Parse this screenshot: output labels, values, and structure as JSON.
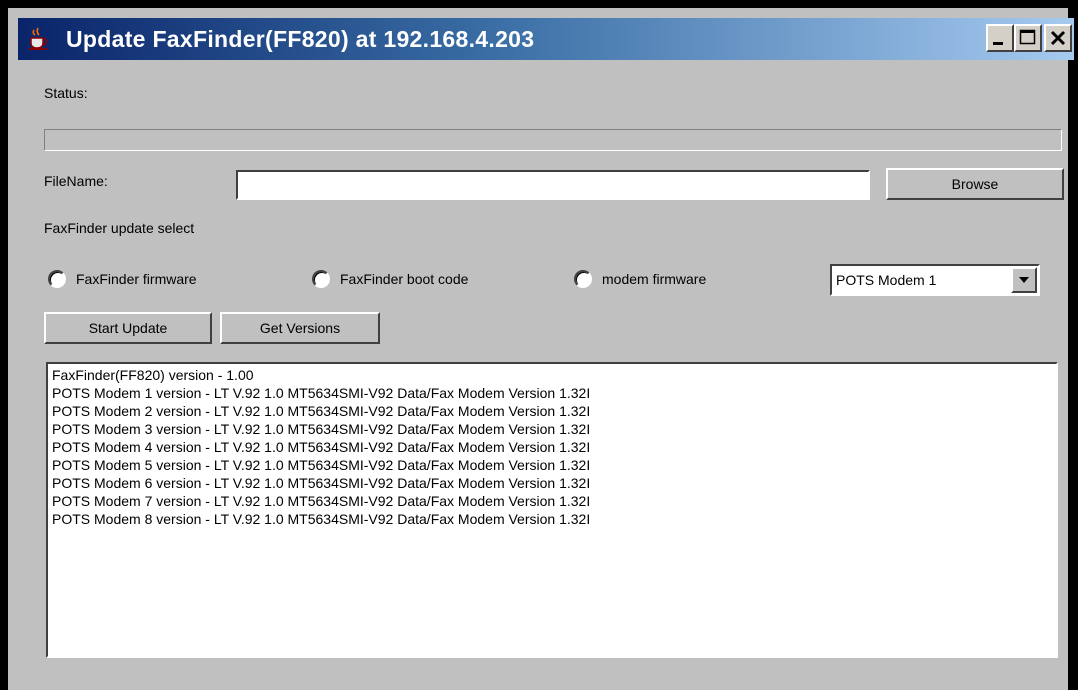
{
  "window": {
    "title": "Update FaxFinder(FF820) at 192.168.4.203",
    "controls": [
      "minimize-icon",
      "maximize-icon",
      "close-icon"
    ]
  },
  "status": {
    "label": "Status:",
    "progress": 0
  },
  "file": {
    "label": "FileName:",
    "value": "",
    "browse_label": "Browse"
  },
  "update_select": {
    "label": "FaxFinder update select",
    "options": [
      "FaxFinder firmware",
      "FaxFinder boot code",
      "modem firmware"
    ],
    "modem_select_value": "POTS Modem 1"
  },
  "actions": {
    "start_label": "Start Update",
    "versions_label": "Get Versions"
  },
  "output": {
    "lines": [
      "FaxFinder(FF820) version - 1.00",
      "POTS Modem 1 version - LT V.92 1.0 MT5634SMI-V92 Data/Fax Modem Version 1.32I",
      "POTS Modem 2 version - LT V.92 1.0 MT5634SMI-V92 Data/Fax Modem Version 1.32I",
      "POTS Modem 3 version - LT V.92 1.0 MT5634SMI-V92 Data/Fax Modem Version 1.32I",
      "POTS Modem 4 version - LT V.92 1.0 MT5634SMI-V92 Data/Fax Modem Version 1.32I",
      "POTS Modem 5 version - LT V.92 1.0 MT5634SMI-V92 Data/Fax Modem Version 1.32I",
      "POTS Modem 6 version - LT V.92 1.0 MT5634SMI-V92 Data/Fax Modem Version 1.32I",
      "POTS Modem 7 version - LT V.92 1.0 MT5634SMI-V92 Data/Fax Modem Version 1.32I",
      "POTS Modem 8 version - LT V.92 1.0 MT5634SMI-V92 Data/Fax Modem Version 1.32I"
    ]
  },
  "colors": {
    "window_bg": "#c0c0c0",
    "titlebar_start": "#0a246a",
    "titlebar_end": "#a6caf0",
    "title_text": "#ffffff"
  }
}
